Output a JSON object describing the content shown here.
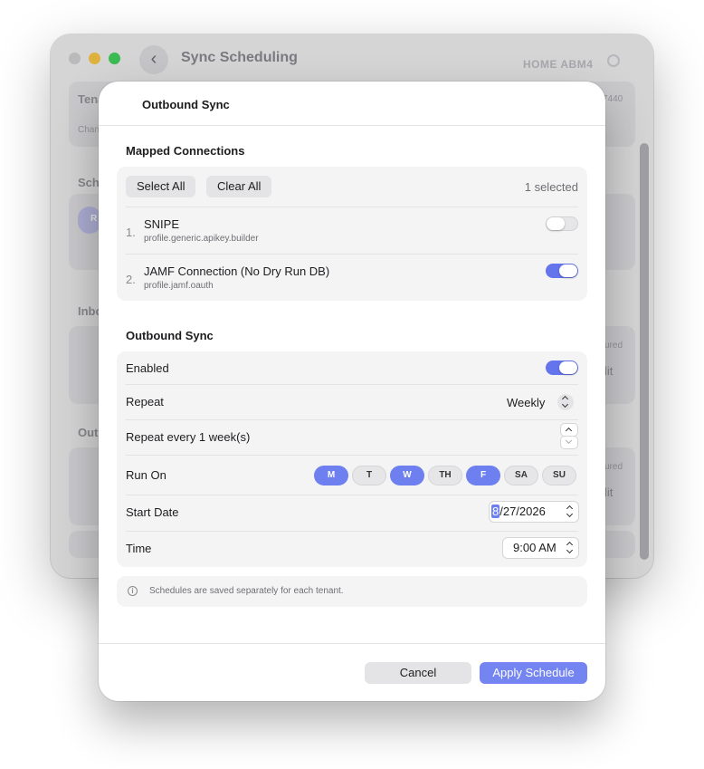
{
  "background_window": {
    "title": "Sync Scheduling",
    "right_label": "HOME ABM4",
    "right_code": "7440",
    "fragments": {
      "tenant": "Tena",
      "tenant_sub": "Chan",
      "schedule": "Sch",
      "inbound": "Inbo",
      "outbound": "Out",
      "configured_1": "ured",
      "edit_1": "lit",
      "configured_2": "ured",
      "edit_2": "lit",
      "pill": "R"
    }
  },
  "sheet": {
    "title": "Outbound Sync",
    "mapped": {
      "title": "Mapped Connections",
      "select_all": "Select All",
      "clear_all": "Clear All",
      "selected_count": "1 selected",
      "connections": [
        {
          "num": "1.",
          "name": "SNIPE",
          "profile": "profile.generic.apikey.builder",
          "enabled": false
        },
        {
          "num": "2.",
          "name": "JAMF Connection (No Dry Run DB)",
          "profile": "profile.jamf.oauth",
          "enabled": true
        }
      ]
    },
    "outbound": {
      "title": "Outbound Sync",
      "enabled_label": "Enabled",
      "enabled": true,
      "repeat_label": "Repeat",
      "repeat_value": "Weekly",
      "repeat_every_label": "Repeat every 1 week(s)",
      "run_on_label": "Run On",
      "days": [
        {
          "label": "M",
          "selected": true
        },
        {
          "label": "T",
          "selected": false
        },
        {
          "label": "W",
          "selected": true
        },
        {
          "label": "TH",
          "selected": false
        },
        {
          "label": "F",
          "selected": true
        },
        {
          "label": "SA",
          "selected": false
        },
        {
          "label": "SU",
          "selected": false
        }
      ],
      "start_date_label": "Start Date",
      "start_date_month": "8",
      "start_date_rest": "/27/2026",
      "time_label": "Time",
      "time_value": "9:00 AM"
    },
    "info_text": "Schedules are saved separately for each tenant.",
    "info_icon": "i",
    "cancel_label": "Cancel",
    "apply_label": "Apply Schedule"
  },
  "colors": {
    "accent": "#6e80f0",
    "toggle_on": "#6474ec",
    "apply_button": "#7485f2"
  },
  "icons": {
    "back": "chevron-left-icon",
    "info": "info-circle-icon"
  }
}
